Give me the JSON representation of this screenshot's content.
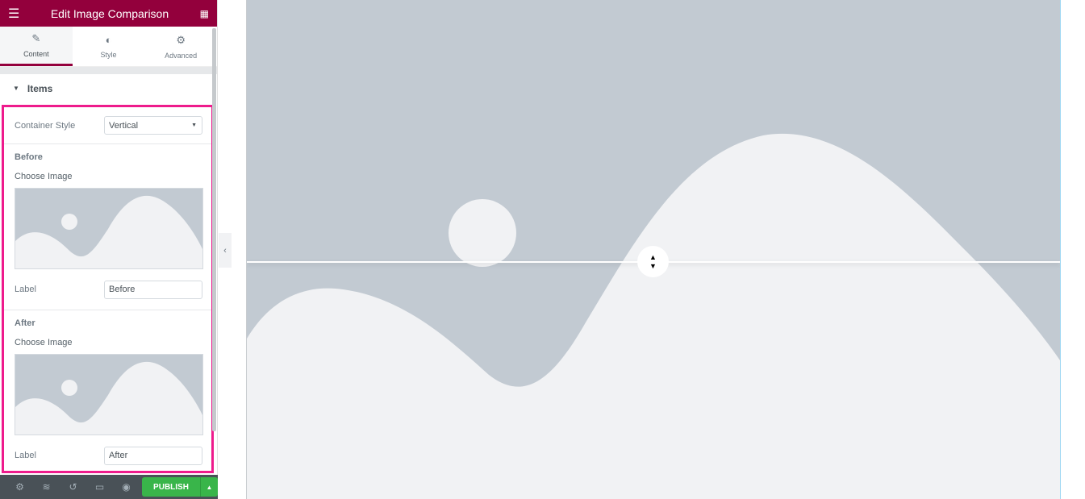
{
  "header": {
    "title": "Edit Image Comparison",
    "menu_icon": "hamburger-icon",
    "apps_icon": "grid-icon"
  },
  "tabs": [
    {
      "label": "Content",
      "icon": "pencil-icon"
    },
    {
      "label": "Style",
      "icon": "contrast-icon"
    },
    {
      "label": "Advanced",
      "icon": "gear-icon"
    }
  ],
  "section": {
    "title": "Items"
  },
  "container_style": {
    "label": "Container Style",
    "value": "Vertical"
  },
  "before": {
    "heading": "Before",
    "choose": "Choose Image",
    "label": "Label",
    "value": "Before"
  },
  "after": {
    "heading": "After",
    "choose": "Choose Image",
    "label": "Label",
    "value": "After"
  },
  "footer": {
    "publish": "PUBLISH"
  },
  "colors": {
    "brand": "#93003c",
    "highlight": "#ee1b8c",
    "publish": "#39b54a",
    "placeholder_bg": "#c2cad2",
    "placeholder_fg": "#f1f2f4"
  }
}
